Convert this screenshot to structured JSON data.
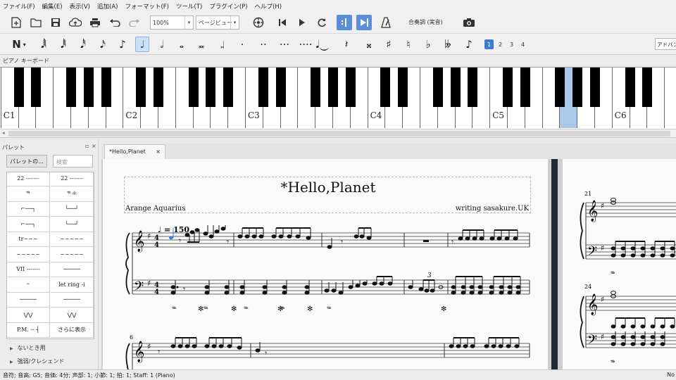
{
  "menu": [
    "ファイル(F)",
    "編集(E)",
    "表示(V)",
    "追加(A)",
    "フォーマット(F)",
    "ツール(T)",
    "プラグイン(P)",
    "ヘルプ(H)"
  ],
  "toolbar": {
    "zoom": "100%",
    "view_mode": "ページビュー",
    "concert_pitch": "合奏調 (実音)"
  },
  "note_input": {
    "voices": [
      "1",
      "2",
      "3",
      "4"
    ],
    "active_voice": "1",
    "advanced": "アドバンス"
  },
  "piano": {
    "label": "ピアノ キーボード",
    "octave_labels": [
      "C1",
      "C2",
      "C3",
      "C4",
      "C5",
      "C6"
    ],
    "highlighted_key": "G5"
  },
  "palette": {
    "title": "パレット",
    "palettes_button": "パレットの...",
    "search_placeholder": "検索",
    "cells": [
      "22 -------",
      "22 -------",
      "𝆮",
      "𝆮 ✻",
      "⌐──┐",
      "└──┘",
      "⌐──┐",
      "└──┘",
      "tr~~~",
      "~~~~~",
      "~~~~~",
      "~~~~~",
      "VII -------",
      "─────",
      "𝄐",
      "let ring -i",
      "─────",
      "─────",
      "⋁⋁",
      "⋁⋁",
      "P.M. -- ┤",
      "さらに表示"
    ],
    "sections": [
      "ないとき用",
      "強弱/クレシェンド"
    ]
  },
  "tab": {
    "label": "*Hello,Planet",
    "close": "×"
  },
  "score": {
    "title": "*Hello,Planet",
    "subtitle_left": "Arange Aquarius",
    "subtitle_right": "writing sasakure.UK",
    "tempo": "♩ = 150",
    "tuplet": "3",
    "measure_numbers": [
      "6",
      "21",
      "24"
    ]
  },
  "status": {
    "text": "音符; 音高: G5; 音価: 4分; 声部: 1; 小節: 1; 拍: 1; Staff: 1 (Piano)",
    "right": "No"
  },
  "colors": {
    "accent": "#3d7bd0",
    "highlight_key": "#a9c8ea",
    "selected_note": "#3d7bd0"
  }
}
